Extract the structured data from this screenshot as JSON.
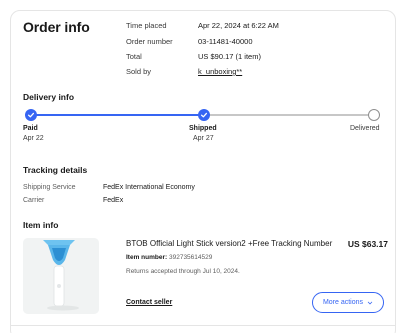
{
  "order": {
    "title": "Order info",
    "time_placed_label": "Time placed",
    "time_placed_value": "Apr 22, 2024 at 6:22 AM",
    "order_number_label": "Order number",
    "order_number_value": "03-11481-40000",
    "total_label": "Total",
    "total_value": "US $90.17 (1 item)",
    "sold_by_label": "Sold by",
    "sold_by_value": "k_unboxing**"
  },
  "delivery": {
    "title": "Delivery info",
    "progress_fraction": 0.67,
    "steps": [
      {
        "label": "Paid",
        "date": "Apr 22",
        "state": "done"
      },
      {
        "label": "Shipped",
        "date": "Apr 27",
        "state": "done"
      },
      {
        "label": "Delivered",
        "date": "",
        "state": "pending"
      }
    ]
  },
  "tracking": {
    "title": "Tracking details",
    "service_label": "Shipping Service",
    "service_value": "FedEx International Economy",
    "carrier_label": "Carrier",
    "carrier_value": "FedEx"
  },
  "item": {
    "section_title": "Item info",
    "title": "BTOB Official Light Stick version2 +Free Tracking Number",
    "price": "US $63.17",
    "number_label": "Item number:",
    "number_value": "392735614529",
    "returns": "Returns accepted through Jul 10, 2024.",
    "contact_label": "Contact seller",
    "more_actions_label": "More actions"
  },
  "colors": {
    "accent": "#3665f3",
    "pending": "#c7c7c7"
  }
}
